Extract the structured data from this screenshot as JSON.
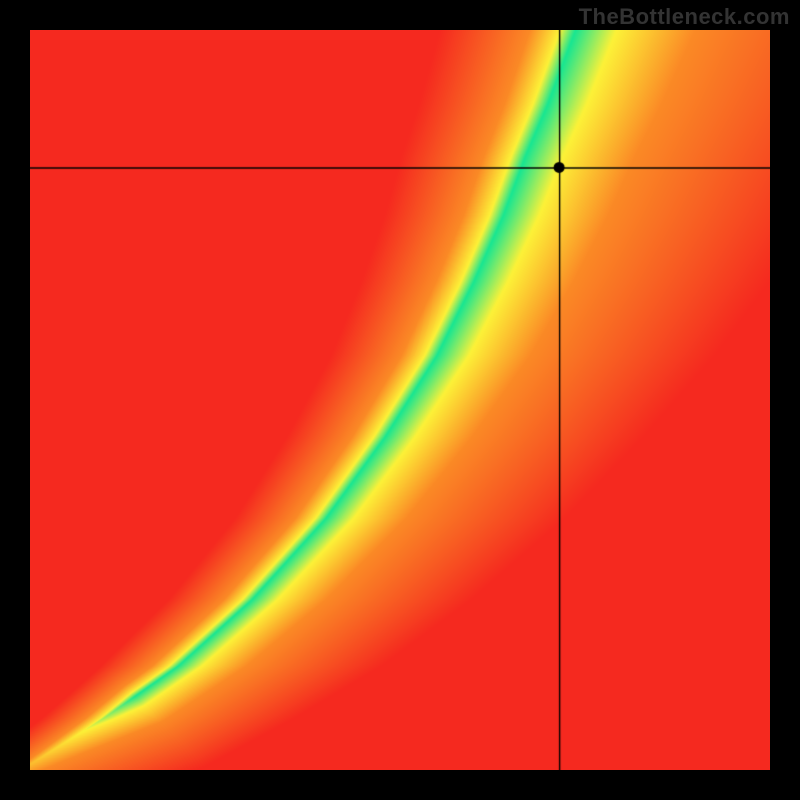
{
  "watermark": "TheBottleneck.com",
  "chart_data": {
    "type": "heatmap",
    "title": "",
    "xlabel": "",
    "ylabel": "",
    "xlim": [
      0,
      1
    ],
    "ylim": [
      0,
      1
    ],
    "marker": {
      "x": 0.716,
      "y": 0.814
    },
    "crosshair": {
      "x": 0.716,
      "y": 0.814
    },
    "optimal_curve": [
      {
        "x": 0.02,
        "y": 0.02
      },
      {
        "x": 0.1,
        "y": 0.07
      },
      {
        "x": 0.2,
        "y": 0.14
      },
      {
        "x": 0.3,
        "y": 0.23
      },
      {
        "x": 0.4,
        "y": 0.34
      },
      {
        "x": 0.48,
        "y": 0.45
      },
      {
        "x": 0.55,
        "y": 0.56
      },
      {
        "x": 0.6,
        "y": 0.66
      },
      {
        "x": 0.64,
        "y": 0.75
      },
      {
        "x": 0.67,
        "y": 0.83
      },
      {
        "x": 0.7,
        "y": 0.9
      },
      {
        "x": 0.73,
        "y": 0.98
      }
    ],
    "palette": {
      "red": "#f5291f",
      "orange": "#fb8a26",
      "yellow": "#fdf238",
      "green": "#18e692"
    }
  }
}
